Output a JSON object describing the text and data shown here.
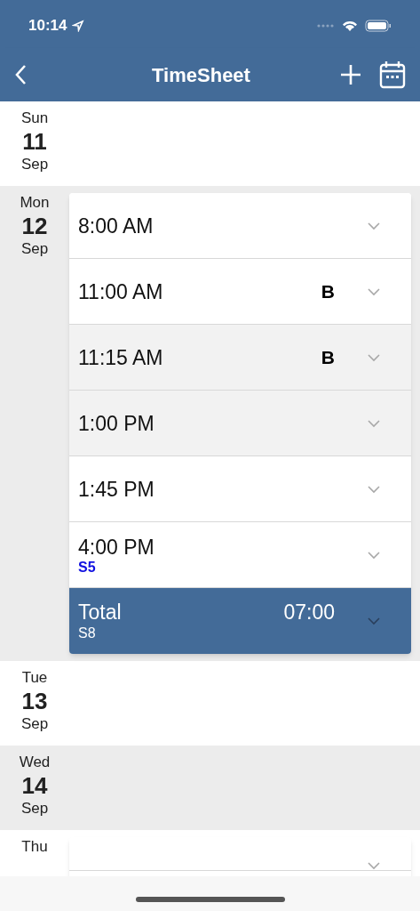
{
  "status_bar": {
    "time": "10:14"
  },
  "nav": {
    "title": "TimeSheet"
  },
  "days": [
    {
      "weekday": "Sun",
      "day": "11",
      "month": "Sep",
      "shaded": false
    },
    {
      "weekday": "Mon",
      "day": "12",
      "month": "Sep",
      "shaded": true,
      "entries": [
        {
          "time": "8:00 AM",
          "shaded": false
        },
        {
          "time": "11:00 AM",
          "flag": "B",
          "shaded": false
        },
        {
          "time": "11:15 AM",
          "flag": "B",
          "shaded": true
        },
        {
          "time": "1:00 PM",
          "shaded": true
        },
        {
          "time": "1:45 PM",
          "shaded": false
        },
        {
          "time": "4:00 PM",
          "note": "S5",
          "shaded": false
        }
      ],
      "total": {
        "label": "Total",
        "value": "07:00",
        "note": "S8"
      }
    },
    {
      "weekday": "Tue",
      "day": "13",
      "month": "Sep",
      "shaded": false
    },
    {
      "weekday": "Wed",
      "day": "14",
      "month": "Sep",
      "shaded": true
    },
    {
      "weekday": "Thu",
      "shaded": false,
      "entries": [
        {
          "shaded": false
        }
      ]
    }
  ]
}
